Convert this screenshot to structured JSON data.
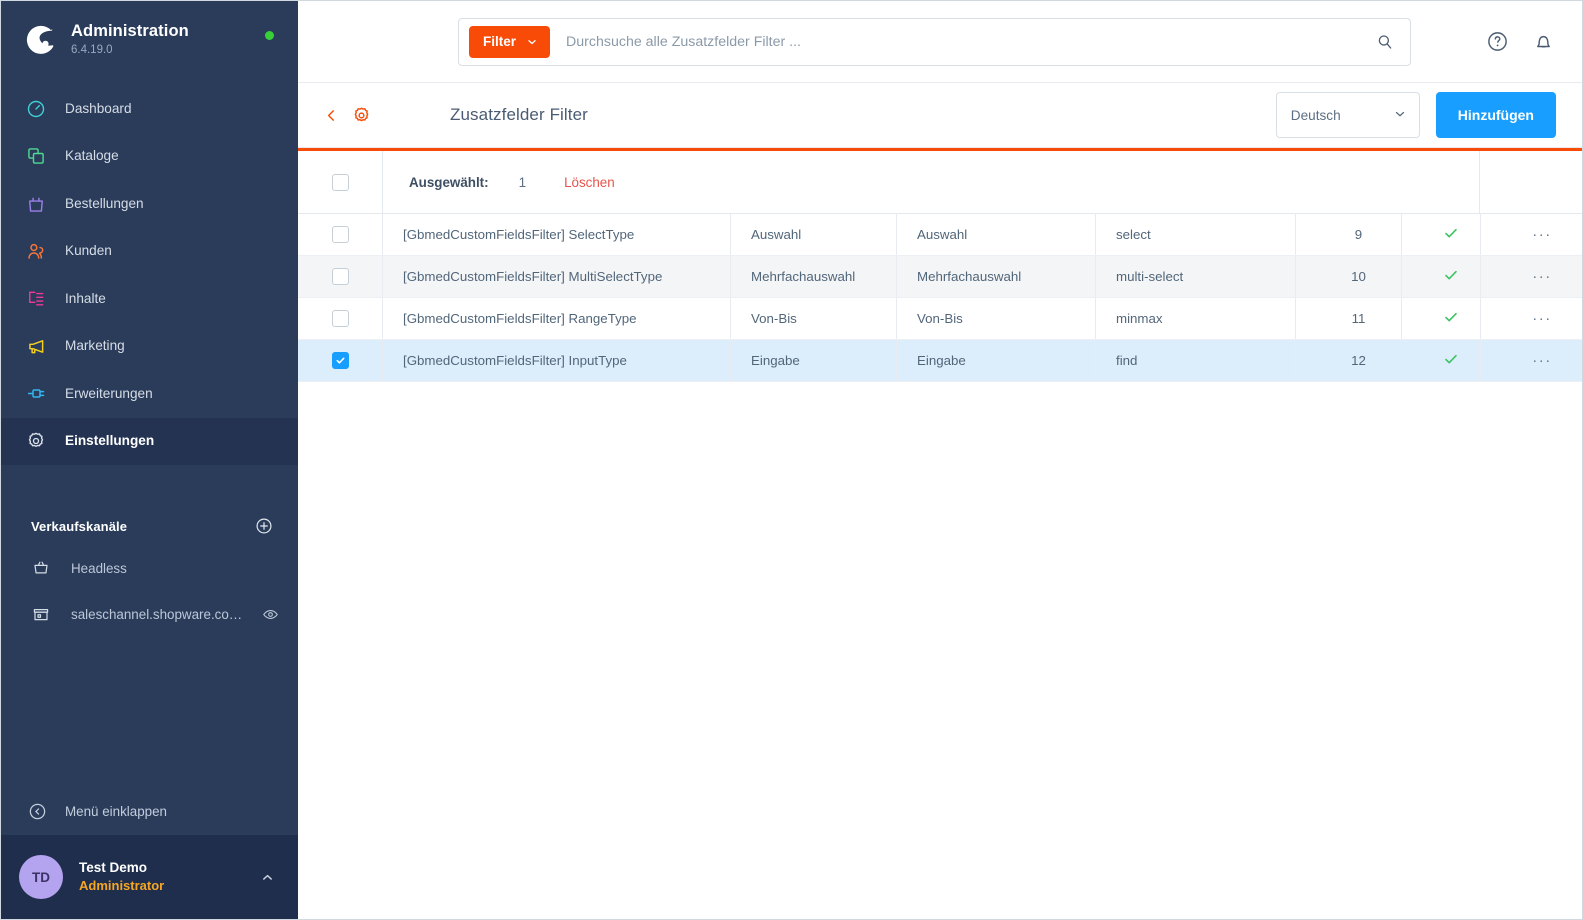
{
  "sidebar": {
    "brand": {
      "title": "Administration",
      "version": "6.4.19.0",
      "logo_icon": "shopware-logo-icon",
      "status_icon": "status-dot-online"
    },
    "items": [
      {
        "label": "Dashboard",
        "icon": "dashboard-icon",
        "color": "#3ecfd6"
      },
      {
        "label": "Kataloge",
        "icon": "catalog-icon",
        "color": "#4ddb8f"
      },
      {
        "label": "Bestellungen",
        "icon": "orders-bag-icon",
        "color": "#9b7fe8"
      },
      {
        "label": "Kunden",
        "icon": "customers-icon",
        "color": "#f5763a"
      },
      {
        "label": "Inhalte",
        "icon": "content-icon",
        "color": "#f0389a"
      },
      {
        "label": "Marketing",
        "icon": "megaphone-icon",
        "color": "#f5d020"
      },
      {
        "label": "Erweiterungen",
        "icon": "plugin-icon",
        "color": "#31b6f0"
      },
      {
        "label": "Einstellungen",
        "icon": "settings-gear-icon",
        "color": "#d7dde6",
        "active": true
      }
    ],
    "sales_channels": {
      "title": "Verkaufskanäle",
      "add_icon": "plus-circle-icon",
      "items": [
        {
          "label": "Headless",
          "icon": "basket-icon",
          "has_eye": false
        },
        {
          "label": "saleschannel.shopware.co…",
          "icon": "storefront-icon",
          "has_eye": true,
          "eye_icon": "eye-icon"
        }
      ]
    },
    "collapse": {
      "label": "Menü einklappen",
      "icon": "collapse-left-icon"
    },
    "user": {
      "initials": "TD",
      "name": "Test Demo",
      "role": "Administrator",
      "caret_icon": "chevron-up-icon"
    }
  },
  "topbar": {
    "filter_button": "Filter",
    "filter_caret_icon": "chevron-down-icon",
    "search_placeholder": "Durchsuche alle Zusatzfelder Filter ...",
    "search_value": "",
    "search_icon": "search-icon",
    "help_icon": "help-circle-icon",
    "notification_icon": "bell-icon"
  },
  "pagehead": {
    "back_icon": "chevron-left-icon",
    "gear_icon": "settings-gear-icon",
    "title": "Zusatzfelder Filter",
    "language": "Deutsch",
    "language_caret_icon": "chevron-down-icon",
    "add_button": "Hinzufügen"
  },
  "selection_bar": {
    "label": "Ausgewählt:",
    "count": "1",
    "delete_label": "Löschen",
    "header_checkbox_checked": false
  },
  "table": {
    "rows": [
      {
        "checked": false,
        "name": "[GbmedCustomFieldsFilter] SelectType",
        "label1": "Auswahl",
        "label2": "Auswahl",
        "type": "select",
        "position": "9",
        "status_icon": "check-icon"
      },
      {
        "checked": false,
        "name": "[GbmedCustomFieldsFilter] MultiSelectType",
        "label1": "Mehrfachauswahl",
        "label2": "Mehrfachauswahl",
        "type": "multi-select",
        "position": "10",
        "status_icon": "check-icon"
      },
      {
        "checked": false,
        "name": "[GbmedCustomFieldsFilter] RangeType",
        "label1": "Von-Bis",
        "label2": "Von-Bis",
        "type": "minmax",
        "position": "11",
        "status_icon": "check-icon"
      },
      {
        "checked": true,
        "name": "[GbmedCustomFieldsFilter] InputType",
        "label1": "Eingabe",
        "label2": "Eingabe",
        "type": "find",
        "position": "12",
        "status_icon": "check-icon"
      }
    ],
    "row_action_icon": "more-horizontal-icon",
    "row_action_label": "···"
  },
  "colors": {
    "sidebar_bg": "#2a3c5a",
    "sidebar_active": "#243352",
    "accent_orange": "#f84b07",
    "accent_blue": "#189eff",
    "status_green": "#3cc261",
    "danger_red": "#e6544b",
    "selected_row": "#dceefc"
  }
}
